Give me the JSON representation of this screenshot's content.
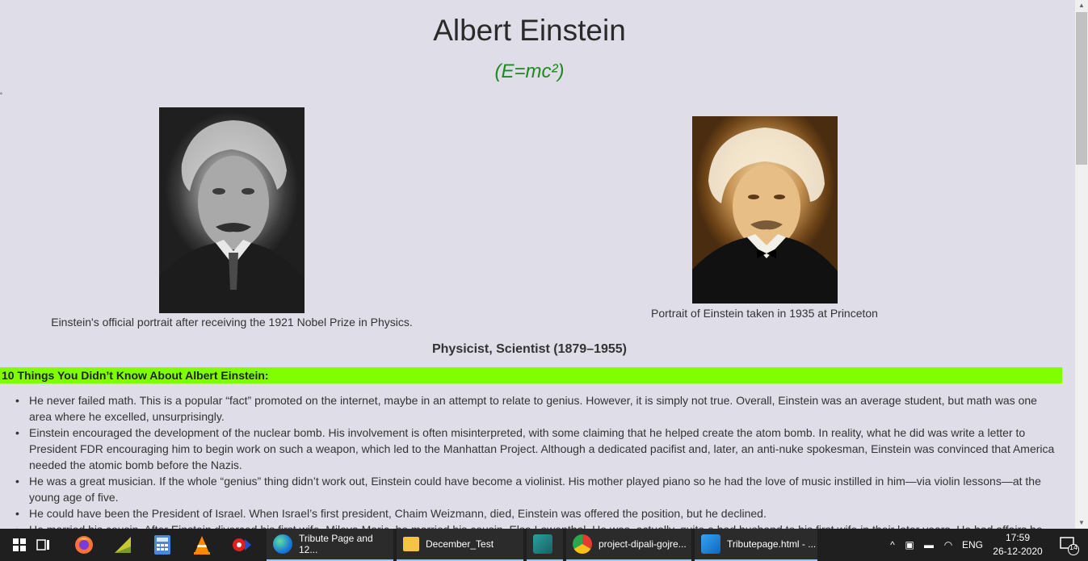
{
  "page": {
    "title": "Albert Einstein",
    "subtitle": "(E=mc²)",
    "stray_mark": "˚",
    "figures": [
      {
        "caption": "Einstein's official portrait after receiving the 1921 Nobel Prize in Physics."
      },
      {
        "caption": "Portrait of Einstein taken in 1935 at Princeton"
      }
    ],
    "subheading": "Physicist, Scientist (1879–1955)",
    "banner": "10 Things You Didn’t Know About Albert Einstein:",
    "facts": [
      "He never failed math. This is a popular “fact” promoted on the internet, maybe in an attempt to relate to genius. However, it is simply not true. Overall, Einstein was an average student, but math was one area where he excelled, unsurprisingly.",
      "Einstein encouraged the development of the nuclear bomb. His involvement is often misinterpreted, with some claiming that he helped create the atom bomb. In reality, what he did was write a letter to President FDR encouraging him to begin work on such a weapon, which led to the Manhattan Project. Although a dedicated pacifist and, later, an anti-nuke spokesman, Einstein was convinced that America needed the atomic bomb before the Nazis.",
      "He was a great musician. If the whole “genius” thing didn’t work out, Einstein could have become a violinist. His mother played piano so he had the love of music instilled in him—via violin lessons—at the young age of five.",
      "He could have been the President of Israel. When Israel’s first president, Chaim Weizmann, died, Einstein was offered the position, but he declined.",
      "He married his cousin. After Einstein divorced his first wife, Mileva Maric, he married his cousin, Elsa Lowenthal. He was, actually, quite a bad husband to his first wife in their later years. He had affairs he"
    ]
  },
  "colors": {
    "background": "#dedde8",
    "subtitle": "#1e8a1e",
    "banner": "#7fff00",
    "taskbar": "#1f1f1f"
  },
  "taskbar": {
    "pinned_icons": [
      "windows-start-icon",
      "task-view-icon",
      "firefox-icon",
      "chart-app-icon",
      "calculator-icon",
      "vlc-icon",
      "media-app-icon"
    ],
    "apps": [
      {
        "label": "Tribute Page and 12...",
        "icon": "edge-icon"
      },
      {
        "label": "December_Test",
        "icon": "folder-icon"
      },
      {
        "label": "",
        "icon": "geometry-app-icon"
      },
      {
        "label": "project-dipali-gojre...",
        "icon": "chrome-icon"
      },
      {
        "label": "Tributepage.html - ...",
        "icon": "vscode-icon"
      }
    ],
    "tray": {
      "language": "ENG",
      "time": "17:59",
      "date": "26-12-2020",
      "notification_count": "14"
    }
  }
}
